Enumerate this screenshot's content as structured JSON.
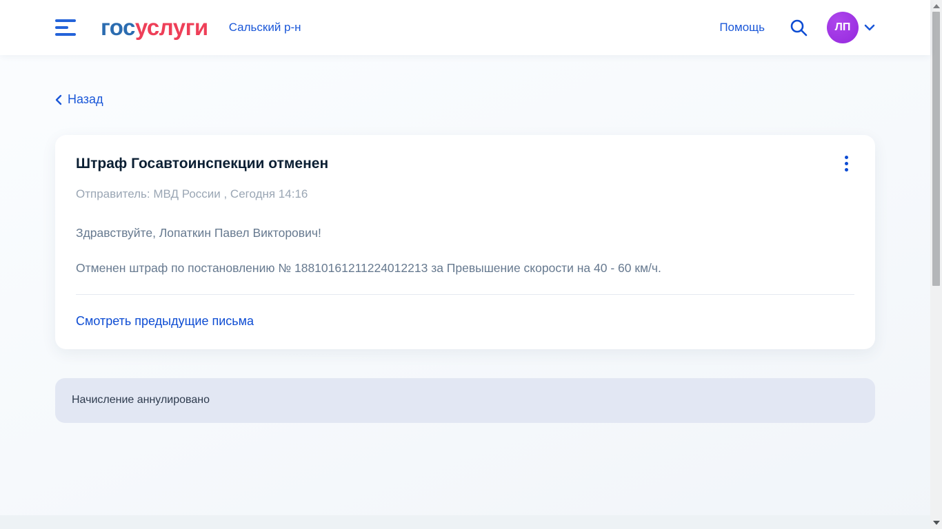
{
  "colors": {
    "accent_blue": "#1a57d8",
    "icon_blue": "#0d4cd3",
    "logo_blue": "#2b6cb0",
    "logo_red": "#ee3f58",
    "avatar_purple": "#9c2ee0",
    "banner_bg": "#e2e7f3",
    "title_dark": "#0b1f33",
    "body_gray": "#66798f",
    "sender_gray": "#9aa6b4"
  },
  "header": {
    "menu_icon": "hamburger-icon",
    "logo_part1": "гос",
    "logo_part2": "услуги",
    "region": "Сальский р-н",
    "help_label": "Помощь",
    "search_icon": "search-icon",
    "avatar_initials": "ЛП",
    "avatar_chevron_icon": "chevron-down-icon"
  },
  "navigation": {
    "back_icon": "chevron-left-icon",
    "back_label": "Назад"
  },
  "message_card": {
    "title": "Штраф Госавтоинспекции отменен",
    "menu_icon": "kebab-menu-icon",
    "sender_line": "Отправитель: МВД России , Сегодня 14:16",
    "greeting": "Здравствуйте, Лопаткин Павел Викторович!",
    "body": "Отменен штраф по постановлению № 18810161211224012213 за Превышение скорости на 40 - 60 км/ч.",
    "previous_letters_link": "Смотреть предыдущие письма"
  },
  "status_banner": {
    "text": "Начисление аннулировано"
  }
}
